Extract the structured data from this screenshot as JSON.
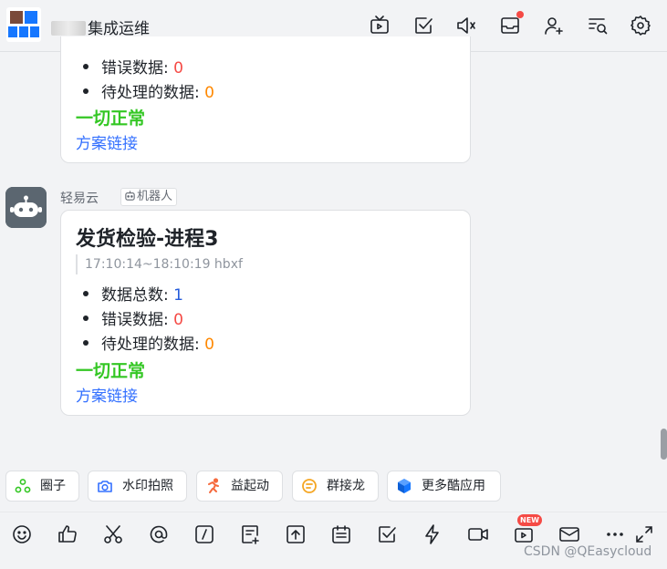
{
  "header": {
    "title": "集成运维",
    "colors": {
      "icon": "#1f2329",
      "alert_dot": "#f54a45"
    },
    "icons": [
      "tv-icon",
      "task-check-icon",
      "mute-speaker-icon",
      "inbox-icon",
      "add-member-icon",
      "search-history-icon",
      "settings-gear-icon"
    ]
  },
  "prev_message": {
    "error_label": "错误数据: ",
    "error_value": "0",
    "pending_label": "待处理的数据: ",
    "pending_value": "0",
    "status": "一切正常",
    "link": "方案链接"
  },
  "message": {
    "sender": "轻易云",
    "sender_tag": "机器人",
    "title": "发货检验-进程3",
    "time_range": "17:10:14~18:10:19 hbxf",
    "total_label": "数据总数: ",
    "total_value": "1",
    "error_label": "错误数据: ",
    "error_value": "0",
    "pending_label": "待处理的数据: ",
    "pending_value": "0",
    "status": "一切正常",
    "link": "方案链接",
    "colors": {
      "error": "#f54a45",
      "pending": "#ff8800",
      "total": "#245bdb",
      "ok": "#34c724",
      "link": "#3370ff"
    }
  },
  "quick_apps": [
    {
      "label": "圈子",
      "icon": "circle-group-icon"
    },
    {
      "label": "水印拍照",
      "icon": "camera-icon"
    },
    {
      "label": "益起动",
      "icon": "running-icon"
    },
    {
      "label": "群接龙",
      "icon": "relay-icon"
    },
    {
      "label": "更多酷应用",
      "icon": "more-apps-icon"
    }
  ],
  "toolbar": {
    "icons": [
      "emoji-icon",
      "thumbs-up-icon",
      "scissors-icon",
      "mention-icon",
      "slash-command-icon",
      "doc-add-icon",
      "upload-file-icon",
      "calendar-icon",
      "task-icon",
      "lightning-icon",
      "video-call-icon",
      "live-icon",
      "mail-icon",
      "more-icon",
      "expand-icon"
    ],
    "new_badge": "NEW"
  },
  "watermark": "CSDN @QEasycloud"
}
